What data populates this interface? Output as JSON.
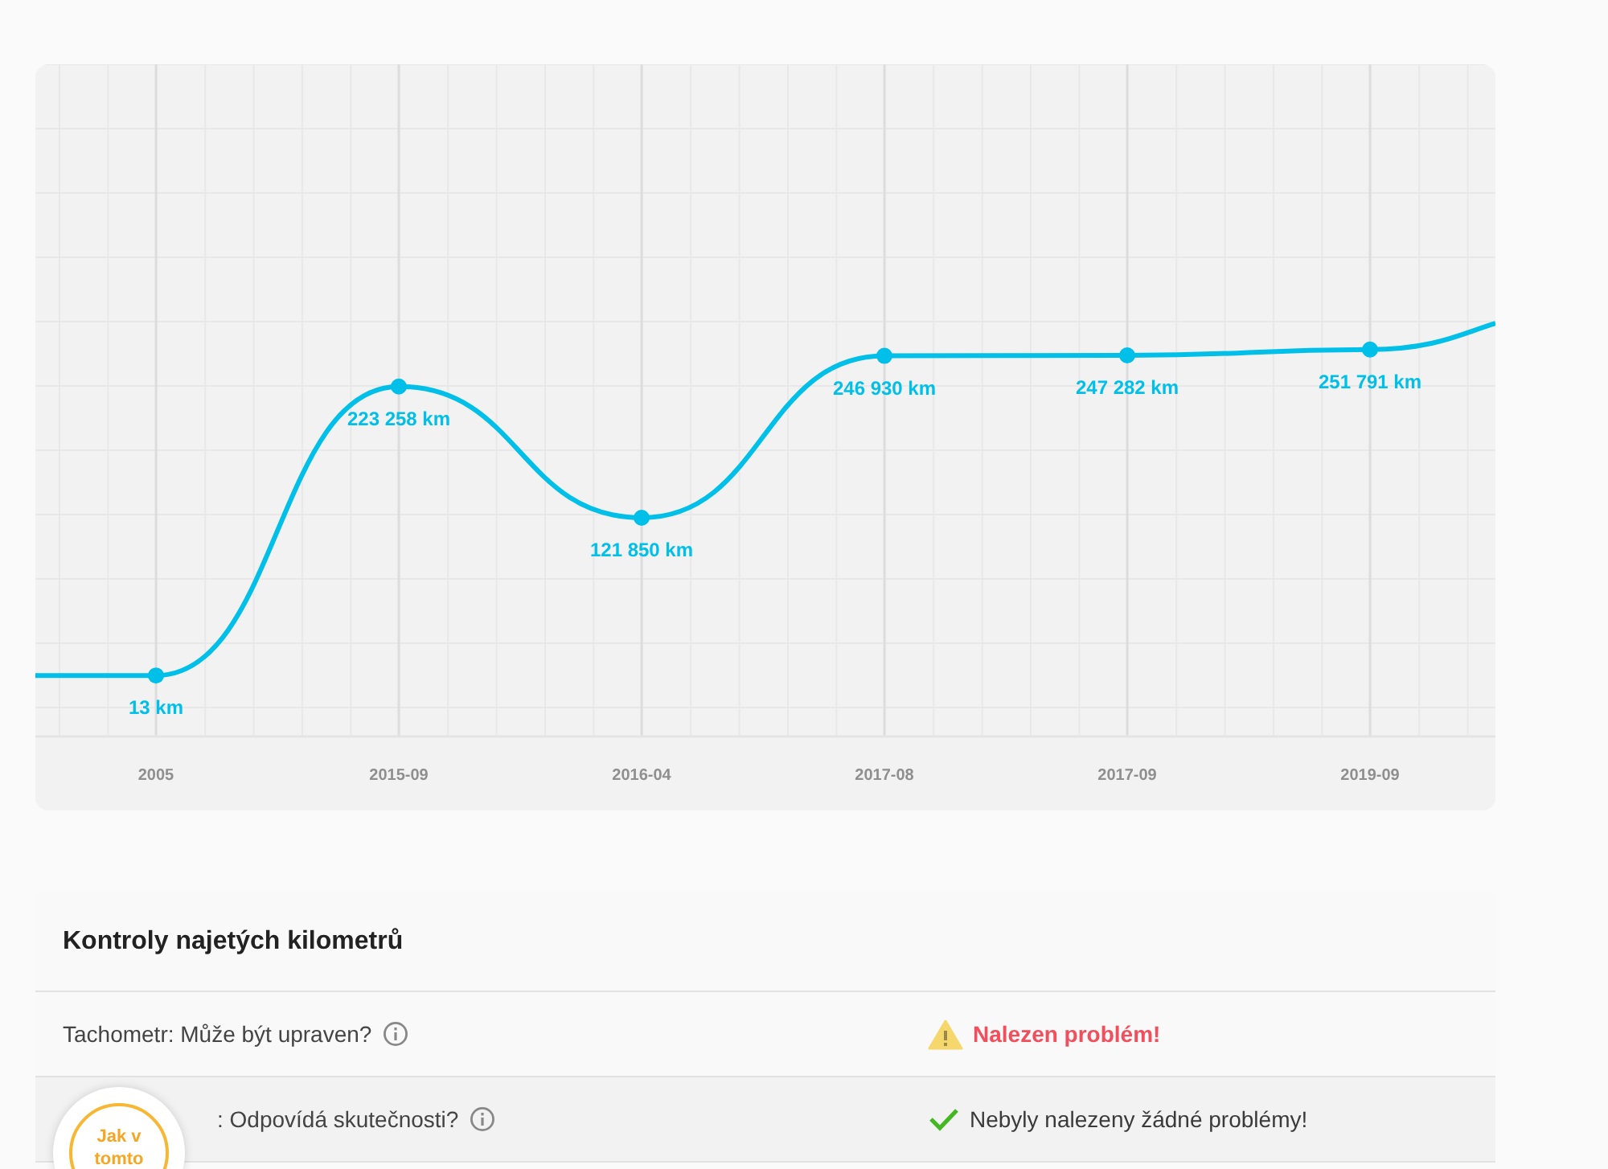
{
  "mileage_chart": {
    "chart_data": {
      "type": "line",
      "categories": [
        "2005",
        "2015-09",
        "2016-04",
        "2017-08",
        "2017-09",
        "2019-09"
      ],
      "series": [
        {
          "color": "#00bfe8",
          "marker": "circle",
          "values": [
            13,
            223258,
            121850,
            246930,
            247282,
            251791
          ],
          "value_labels": [
            "13 km",
            "223 258 km",
            "121 850 km",
            "246 930 km",
            "247 282 km",
            "251 791 km"
          ]
        }
      ],
      "grid": true,
      "data_labels": true
    }
  },
  "checks": {
    "title": "Kontroly najetých kilometrů",
    "rows": [
      {
        "label": "Tachometr: Může být upraven?",
        "result": "Nalezen problém!",
        "kind": "problem"
      },
      {
        "label": ": Odpovídá skutečnosti?",
        "result": "Nebyly nalezeny žádné problémy!",
        "kind": "ok"
      }
    ]
  },
  "help_badge": {
    "label": "Jak v tomto"
  }
}
